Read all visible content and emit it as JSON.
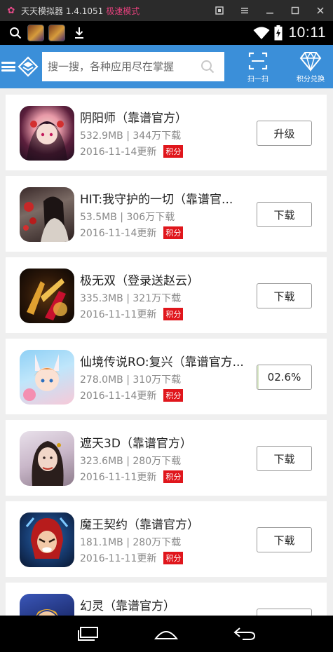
{
  "emulator": {
    "title": "天天模拟器 1.4.1051",
    "mode": "极速模式"
  },
  "status_bar": {
    "time": "10:11"
  },
  "header": {
    "search_placeholder": "搜一搜，各种应用尽在掌握",
    "scan_label": "扫一扫",
    "points_label": "积分兑换"
  },
  "apps": [
    {
      "name": "阴阳师（靠谱官方）",
      "size": "532.9MB",
      "downloads": "344万下载",
      "date": "2016-11-14更新",
      "badge": "积分",
      "action": "升级"
    },
    {
      "name": "HIT:我守护的一切（靠谱官...",
      "size": "53.5MB",
      "downloads": "306万下载",
      "date": "2016-11-14更新",
      "badge": "积分",
      "action": "下载"
    },
    {
      "name": "极无双（登录送赵云）",
      "size": "335.3MB",
      "downloads": "321万下载",
      "date": "2016-11-11更新",
      "badge": "积分",
      "action": "下载"
    },
    {
      "name": "仙境传说RO:复兴（靠谱官方...",
      "size": "278.0MB",
      "downloads": "310万下载",
      "date": "2016-11-14更新",
      "badge": "积分",
      "action": "02.6%",
      "progress": 0.026
    },
    {
      "name": "遮天3D（靠谱官方）",
      "size": "323.6MB",
      "downloads": "280万下载",
      "date": "2016-11-11更新",
      "badge": "积分",
      "action": "下载"
    },
    {
      "name": "魔王契约（靠谱官方）",
      "size": "181.1MB",
      "downloads": "280万下载",
      "date": "2016-11-11更新",
      "badge": "积分",
      "action": "下载"
    },
    {
      "name": "幻灵（靠谱官方）",
      "size": "",
      "downloads": "",
      "date": "",
      "badge": "",
      "action": ""
    }
  ],
  "colors": {
    "header_bg": "#3b8fd9",
    "badge_bg": "#e0161c",
    "emulator_mode": "#e3417c"
  },
  "icons": {
    "status_search": "search-icon",
    "status_download": "download-icon",
    "wifi": "wifi-icon",
    "battery": "battery-icon",
    "menu": "hamburger-menu-icon",
    "logo": "app-store-logo-icon",
    "scan": "scan-icon",
    "points": "diamond-icon",
    "nav_recents": "recent-apps-icon",
    "nav_home": "home-icon",
    "nav_back": "back-icon"
  }
}
